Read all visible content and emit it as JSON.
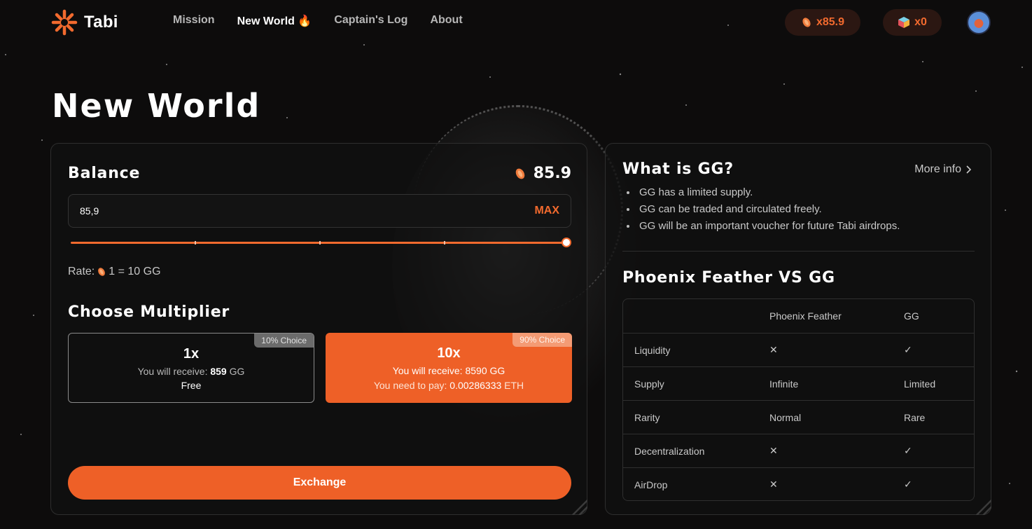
{
  "app": {
    "name": "Tabi"
  },
  "nav": {
    "items": [
      {
        "label": "Mission",
        "active": false
      },
      {
        "label": "New World",
        "emoji": "🔥",
        "active": true
      },
      {
        "label": "Captain's Log",
        "active": false
      },
      {
        "label": "About",
        "active": false
      }
    ],
    "feather_count": "x85.9",
    "cube_count": "x0"
  },
  "page": {
    "title": "New World"
  },
  "exchange": {
    "balance_label": "Balance",
    "balance_value": "85.9",
    "input_value": "85,9",
    "max_label": "MAX",
    "slider_percent": 100,
    "rate_prefix": "Rate:",
    "rate_suffix": "1 = 10 GG",
    "multiplier_title": "Choose Multiplier",
    "options": [
      {
        "multiplier": "1x",
        "badge": "10% Choice",
        "receive_label": "You will receive:",
        "receive_amount": "859",
        "receive_unit": "GG",
        "cost_text": "Free"
      },
      {
        "multiplier": "10x",
        "badge": "90% Choice",
        "receive_label": "You will receive:",
        "receive_amount": "8590",
        "receive_unit": "GG",
        "pay_label": "You need to pay:",
        "pay_amount": "0.00286333",
        "pay_unit": "ETH"
      }
    ],
    "button_label": "Exchange"
  },
  "info": {
    "title": "What is GG?",
    "more_label": "More info",
    "bullets": [
      "GG has a limited supply.",
      "GG can be traded and circulated freely.",
      "GG will be an important voucher for future Tabi airdrops."
    ],
    "compare_title": "Phoenix Feather VS GG",
    "columns": [
      "",
      "Phoenix Feather",
      "GG"
    ],
    "rows": [
      {
        "label": "Liquidity",
        "feather": "✕",
        "gg": "✓"
      },
      {
        "label": "Supply",
        "feather": "Infinite",
        "gg": "Limited"
      },
      {
        "label": "Rarity",
        "feather": "Normal",
        "gg": "Rare"
      },
      {
        "label": "Decentralization",
        "feather": "✕",
        "gg": "✓"
      },
      {
        "label": "AirDrop",
        "feather": "✕",
        "gg": "✓"
      }
    ]
  },
  "colors": {
    "accent": "#ee6027",
    "background": "#0d0c0c",
    "card_border": "#2e2e2e"
  }
}
